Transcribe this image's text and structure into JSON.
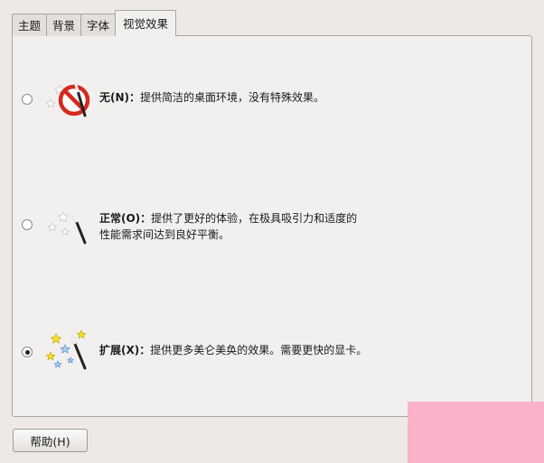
{
  "tabs": [
    {
      "label": "主题",
      "active": false
    },
    {
      "label": "背景",
      "active": false
    },
    {
      "label": "字体",
      "active": false
    },
    {
      "label": "视觉效果",
      "active": true
    }
  ],
  "options": [
    {
      "name": "无(N)：",
      "desc_line1": "提供简洁的桌面环境，没有特殊效果。",
      "desc_line2": "",
      "selected": false,
      "icon": "no-effects-icon"
    },
    {
      "name": "正常(O)：",
      "desc_line1": "提供了更好的体验，在极具吸引力和适度的",
      "desc_line2": "性能需求间达到良好平衡。",
      "selected": false,
      "icon": "normal-effects-wand-icon"
    },
    {
      "name": "扩展(X)：",
      "desc_line1": "提供更多美仑美奂的效果。需要更快的显卡。",
      "desc_line2": "",
      "selected": true,
      "icon": "extra-effects-wand-icon"
    }
  ],
  "help_button": {
    "label": "帮助(H)"
  },
  "colors": {
    "window_bg": "#ede9e5",
    "panel_bg": "#f2f0ee",
    "watermark": "#f9b2ca"
  }
}
